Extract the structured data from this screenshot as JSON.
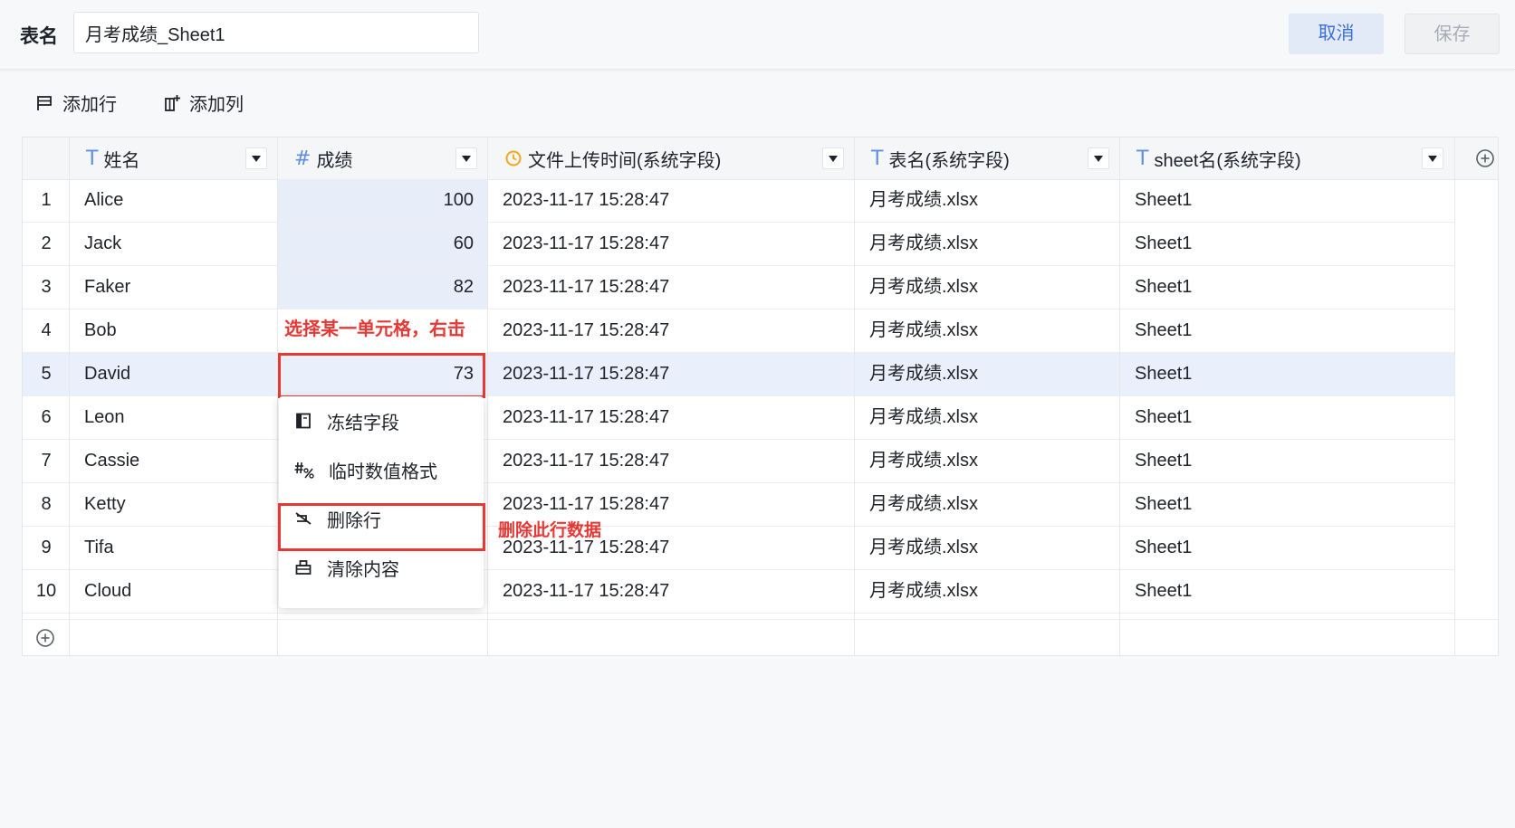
{
  "header": {
    "table_name_label": "表名",
    "table_name_value": "月考成绩_Sheet1",
    "cancel_label": "取消",
    "save_label": "保存"
  },
  "toolbar": {
    "add_row_label": "添加行",
    "add_column_label": "添加列"
  },
  "columns": [
    {
      "label": "姓名",
      "type_icon": "text-type-icon"
    },
    {
      "label": "成绩",
      "type_icon": "number-type-icon"
    },
    {
      "label": "文件上传时间(系统字段)",
      "type_icon": "clock-type-icon"
    },
    {
      "label": "表名(系统字段)",
      "type_icon": "text-type-icon"
    },
    {
      "label": "sheet名(系统字段)",
      "type_icon": "text-type-icon"
    }
  ],
  "rows": [
    {
      "idx": "1",
      "name": "Alice",
      "score": "100",
      "time": "2023-11-17 15:28:47",
      "table": "月考成绩.xlsx",
      "sheet": "Sheet1"
    },
    {
      "idx": "2",
      "name": "Jack",
      "score": "60",
      "time": "2023-11-17 15:28:47",
      "table": "月考成绩.xlsx",
      "sheet": "Sheet1"
    },
    {
      "idx": "3",
      "name": "Faker",
      "score": "82",
      "time": "2023-11-17 15:28:47",
      "table": "月考成绩.xlsx",
      "sheet": "Sheet1"
    },
    {
      "idx": "4",
      "name": "Bob",
      "score": "",
      "time": "2023-11-17 15:28:47",
      "table": "月考成绩.xlsx",
      "sheet": "Sheet1"
    },
    {
      "idx": "5",
      "name": "David",
      "score": "73",
      "time": "2023-11-17 15:28:47",
      "table": "月考成绩.xlsx",
      "sheet": "Sheet1"
    },
    {
      "idx": "6",
      "name": "Leon",
      "score": "",
      "time": "2023-11-17 15:28:47",
      "table": "月考成绩.xlsx",
      "sheet": "Sheet1"
    },
    {
      "idx": "7",
      "name": "Cassie",
      "score": "",
      "time": "2023-11-17 15:28:47",
      "table": "月考成绩.xlsx",
      "sheet": "Sheet1"
    },
    {
      "idx": "8",
      "name": "Ketty",
      "score": "",
      "time": "2023-11-17 15:28:47",
      "table": "月考成绩.xlsx",
      "sheet": "Sheet1"
    },
    {
      "idx": "9",
      "name": "Tifa",
      "score": "",
      "time": "2023-11-17 15:28:47",
      "table": "月考成绩.xlsx",
      "sheet": "Sheet1"
    },
    {
      "idx": "10",
      "name": "Cloud",
      "score": "",
      "time": "2023-11-17 15:28:47",
      "table": "月考成绩.xlsx",
      "sheet": "Sheet1"
    }
  ],
  "selected_row_index": 5,
  "context_menu": {
    "items": [
      {
        "label": "冻结字段",
        "icon": "freeze-column-icon"
      },
      {
        "label": "临时数值格式",
        "icon": "number-format-icon"
      },
      {
        "label": "删除行",
        "icon": "delete-row-icon"
      },
      {
        "label": "清除内容",
        "icon": "clear-content-icon"
      }
    ]
  },
  "annotations": {
    "select_cell_hint": "选择某一单元格，右击",
    "delete_row_hint": "删除此行数据"
  },
  "colors": {
    "accent": "#3a6fd9",
    "selection": "#eaf0fb",
    "annotation_red": "#e53935"
  }
}
